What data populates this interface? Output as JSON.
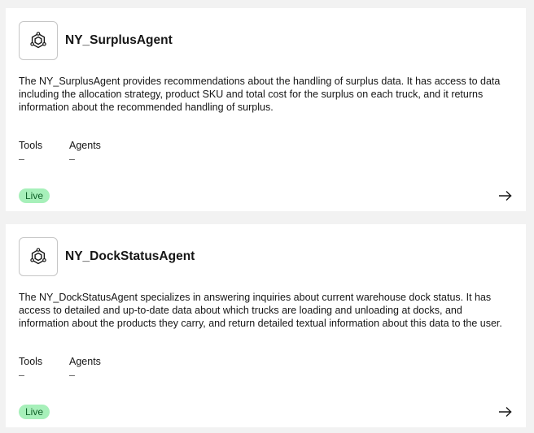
{
  "agents": [
    {
      "name": "NY_SurplusAgent",
      "icon": "agent-hexagon-icon",
      "description": "The NY_SurplusAgent provides recommendations about the handling of surplus data. It has access to data including the allocation strategy, product SKU and total cost for the surplus on each truck, and it returns information about the recommended handling of surplus.",
      "tools_label": "Tools",
      "tools_value": "–",
      "agents_label": "Agents",
      "agents_value": "–",
      "status": "Live",
      "action_icon": "arrow-right-icon"
    },
    {
      "name": "NY_DockStatusAgent",
      "icon": "agent-hexagon-icon",
      "description": "The NY_DockStatusAgent specializes in answering inquiries about current warehouse dock status. It has access to detailed and up-to-date data about which trucks are loading and unloading at docks, and information about the products they carry, and return detailed textual information about this data to the user.",
      "tools_label": "Tools",
      "tools_value": "–",
      "agents_label": "Agents",
      "agents_value": "–",
      "status": "Live",
      "action_icon": "arrow-right-icon"
    }
  ],
  "colors": {
    "background": "#f2f2f2",
    "card": "#ffffff",
    "live_badge_bg": "#a7f0ba",
    "live_badge_text": "#0e6027"
  }
}
